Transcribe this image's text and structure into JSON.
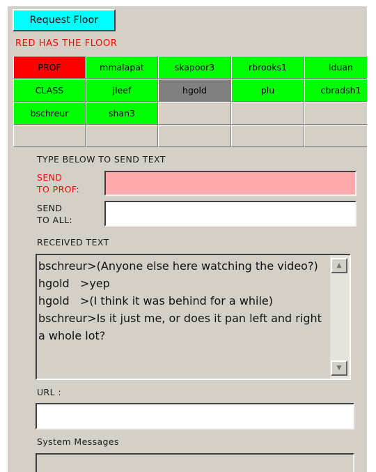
{
  "controls": {
    "request_floor": "Request Floor"
  },
  "floor_status": "RED HAS THE FLOOR",
  "participants": [
    {
      "name": "PROF",
      "state": "red"
    },
    {
      "name": "mmalapat",
      "state": "green"
    },
    {
      "name": "skapoor3",
      "state": "green"
    },
    {
      "name": "rbrooks1",
      "state": "green"
    },
    {
      "name": "lduan",
      "state": "green"
    },
    {
      "name": "CLASS",
      "state": "green"
    },
    {
      "name": "jleef",
      "state": "green"
    },
    {
      "name": "hgold",
      "state": "gray"
    },
    {
      "name": "plu",
      "state": "green"
    },
    {
      "name": "cbradsh1",
      "state": "green"
    },
    {
      "name": "bschreur",
      "state": "green"
    },
    {
      "name": "shan3",
      "state": "green"
    },
    {
      "name": "",
      "state": "empty"
    },
    {
      "name": "",
      "state": "empty"
    },
    {
      "name": "",
      "state": "empty"
    },
    {
      "name": "",
      "state": "empty"
    },
    {
      "name": "",
      "state": "empty"
    },
    {
      "name": "",
      "state": "empty"
    },
    {
      "name": "",
      "state": "empty"
    },
    {
      "name": "",
      "state": "empty"
    }
  ],
  "colors": {
    "red": "#ff0000",
    "green": "#00ff00",
    "gray": "#808080",
    "empty": "#d4d0c8",
    "accent": "#00ffff",
    "prof_field": "#ffaaaa"
  },
  "send": {
    "heading": "TYPE BELOW TO SEND TEXT",
    "to_prof_line1": "SEND",
    "to_prof_line2": "TO PROF:",
    "to_prof_value": "",
    "to_all_line1": "SEND",
    "to_all_line2": "TO ALL:",
    "to_all_value": ""
  },
  "received": {
    "heading": "RECEIVED TEXT",
    "text": "bschreur>(Anyone else here watching the video?)\nhgold   >yep\nhgold   >(I think it was behind for a while)\nbschreur>Is it just me, or does it pan left and right a whole lot?"
  },
  "url": {
    "label": "URL :",
    "value": ""
  },
  "system": {
    "label": "System Messages",
    "value": ""
  },
  "icons": {
    "scroll_up": "up-arrow-icon",
    "scroll_down": "down-arrow-icon"
  }
}
